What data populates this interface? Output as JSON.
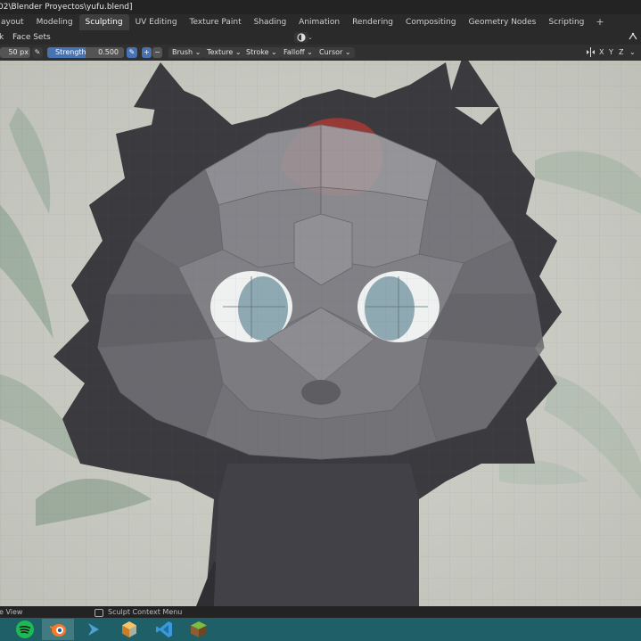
{
  "window": {
    "title": "02\\Blender Proyectos\\yufu.blend]"
  },
  "workspaces": {
    "tabs": [
      {
        "label": "ayout",
        "active": false
      },
      {
        "label": "Modeling",
        "active": false
      },
      {
        "label": "Sculpting",
        "active": true
      },
      {
        "label": "UV Editing",
        "active": false
      },
      {
        "label": "Texture Paint",
        "active": false
      },
      {
        "label": "Shading",
        "active": false
      },
      {
        "label": "Animation",
        "active": false
      },
      {
        "label": "Rendering",
        "active": false
      },
      {
        "label": "Compositing",
        "active": false
      },
      {
        "label": "Geometry Nodes",
        "active": false
      },
      {
        "label": "Scripting",
        "active": false
      }
    ],
    "add_label": "+"
  },
  "menubar": {
    "mask_label": "k",
    "face_sets_label": "Face Sets"
  },
  "toolbar": {
    "radius": "50 px",
    "strength_label": "Strength",
    "strength_value": "0.500",
    "strength_fraction": 0.5,
    "plus": "+",
    "minus": "−",
    "dropdowns": {
      "brush": "Brush",
      "texture": "Texture",
      "stroke": "Stroke",
      "falloff": "Falloff",
      "cursor": "Cursor"
    },
    "axes": {
      "x": "X",
      "y": "Y",
      "z": "Z"
    }
  },
  "statusbar": {
    "left_label": "e View",
    "context_menu_label": "Sculpt Context Menu"
  },
  "taskbar": {
    "apps": [
      {
        "icon": "spotify-icon",
        "color": "#1db954"
      },
      {
        "icon": "blender-icon",
        "color": "#f5792a"
      },
      {
        "icon": "terminal-arrow-icon",
        "color": "#4ea1d3"
      },
      {
        "icon": "cube-app-icon",
        "color": "#e9a13b"
      },
      {
        "icon": "vscode-icon",
        "color": "#3a9ad9"
      },
      {
        "icon": "minecraft-icon",
        "color": "#5b8c32"
      }
    ]
  },
  "colors": {
    "accent": "#4772b3",
    "panel": "#303030",
    "header": "#2a2a2a",
    "taskbar": "#1f6068",
    "viewport_bg": "#c9cac3",
    "fur": "#3b3a3f",
    "mesh": "#7e7e82",
    "tuft": "#b23a35"
  }
}
